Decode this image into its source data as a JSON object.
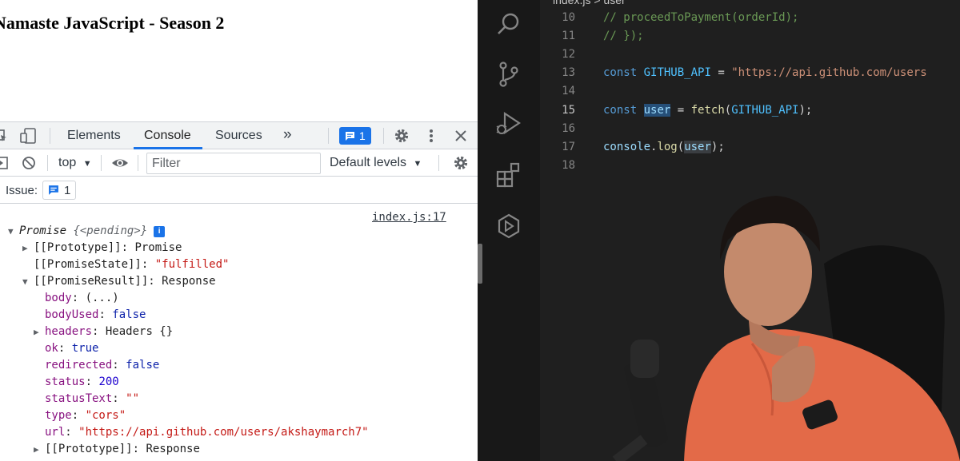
{
  "browser_page": {
    "heading": "Namaste JavaScript - Season 2"
  },
  "devtools": {
    "tabs": [
      "Elements",
      "Console",
      "Sources"
    ],
    "active_tab": "Console",
    "more_tabs_label": "»",
    "issues_badge_count": "1",
    "toolbar": {
      "context_label": "top",
      "filter_placeholder": "Filter",
      "levels_label": "Default levels"
    },
    "issues_bar": {
      "label": "Issue:",
      "count": "1"
    },
    "console": {
      "source_link": "index.js:17",
      "root": "Promise",
      "root_state": "{<pending>}",
      "lines": [
        {
          "key": "[[Prototype]]",
          "value": "Promise"
        },
        {
          "key": "[[PromiseState]]",
          "value": "\"fulfilled\""
        },
        {
          "key": "[[PromiseResult]]",
          "value": "Response"
        },
        {
          "key": "body",
          "value": "(...)"
        },
        {
          "key": "bodyUsed",
          "value": "false"
        },
        {
          "key": "headers",
          "value": "Headers {}"
        },
        {
          "key": "ok",
          "value": "true"
        },
        {
          "key": "redirected",
          "value": "false"
        },
        {
          "key": "status",
          "value": "200"
        },
        {
          "key": "statusText",
          "value": "\"\""
        },
        {
          "key": "type",
          "value": "\"cors\""
        },
        {
          "key": "url",
          "value": "\"https://api.github.com/users/akshaymarch7\""
        },
        {
          "key": "[[Prototype]]",
          "value": "Response"
        }
      ]
    }
  },
  "editor": {
    "breadcrumb": "index.js > user",
    "lines": [
      {
        "n": "10",
        "text": "//   proceedToPayment(orderId);"
      },
      {
        "n": "11",
        "text": "// });"
      },
      {
        "n": "12",
        "text": ""
      },
      {
        "n": "13",
        "kw": "const",
        "name": "GITHUB_API",
        "op": " = ",
        "str": "\"https://api.github.com/users"
      },
      {
        "n": "14",
        "text": ""
      },
      {
        "n": "15",
        "kw": "const",
        "name": "user",
        "op": " = ",
        "fn": "fetch",
        "arg": "GITHUB_API",
        "end": ");"
      },
      {
        "n": "16",
        "text": ""
      },
      {
        "n": "17",
        "obj": "console",
        "dot": ".",
        "fn": "log",
        "arg": "user",
        "end": ");"
      },
      {
        "n": "18",
        "text": ""
      }
    ],
    "current_line": "15"
  },
  "icons": {
    "devtools": [
      "inspect-icon",
      "device-toolbar-icon",
      "message-icon",
      "gear-icon",
      "kebab-menu-icon",
      "close-icon",
      "sidebar-toggle-icon",
      "clear-console-icon",
      "eye-icon",
      "info-icon"
    ],
    "activity_bar": [
      "search-icon",
      "source-control-icon",
      "run-debug-icon",
      "extensions-icon",
      "remote-explorer-icon"
    ]
  },
  "colors": {
    "devtools_accent": "#1a73e8",
    "editor_bg": "#1f1f1f",
    "activity_bar_bg": "#181818",
    "selection_highlight": "#264f78"
  }
}
